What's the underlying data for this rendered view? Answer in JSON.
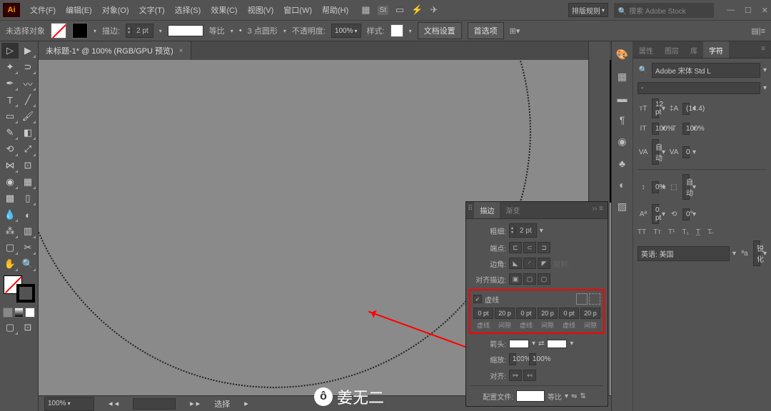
{
  "titlebar": {
    "logo": "Ai",
    "menu": [
      "文件(F)",
      "编辑(E)",
      "对象(O)",
      "文字(T)",
      "选择(S)",
      "效果(C)",
      "视图(V)",
      "窗口(W)",
      "帮助(H)"
    ],
    "layout_label": "排版规则",
    "search_placeholder": "🔍 搜索 Adobe Stock"
  },
  "controlbar": {
    "no_selection": "未选择对象",
    "stroke_label": "描边:",
    "stroke_weight": "2 pt",
    "profile_label": "等比",
    "brush_label": "3 点圆形",
    "opacity_label": "不透明度:",
    "opacity_value": "100%",
    "style_label": "样式:",
    "doc_setup": "文档设置",
    "prefs": "首选项"
  },
  "doc": {
    "tab_title": "未标题-1* @ 100% (RGB/GPU 预览)"
  },
  "status": {
    "zoom": "100%",
    "select_label": "选择"
  },
  "char_panel": {
    "tabs": [
      "属性",
      "图层",
      "库",
      "字符"
    ],
    "font": "Adobe 宋体 Std L",
    "style": "-",
    "size": "12 pt",
    "leading": "(14.4)",
    "vscale": "100%",
    "hscale": "100%",
    "kerning": "自动",
    "tracking": "0",
    "baseline": "0%",
    "color_auto": "自动",
    "shift": "0 pt",
    "rotation": "0°",
    "language": "英语: 美国",
    "aa": "锐化"
  },
  "stroke_panel": {
    "tabs": [
      "描边",
      "渐变"
    ],
    "weight_label": "粗细:",
    "weight": "2 pt",
    "cap_label": "端点:",
    "corner_label": "边角:",
    "limit_label": "限制:",
    "align_label": "对齐描边:",
    "dash_label": "虚线",
    "dash_values": [
      "0 pt",
      "20 p",
      "0 pt",
      "20 p",
      "0 pt",
      "20 p"
    ],
    "dash_sublabels": [
      "虚线",
      "间隙",
      "虚线",
      "间隙",
      "虚线",
      "间隙"
    ],
    "arrow_label": "箭头:",
    "scale_label": "缩放:",
    "scale1": "100%",
    "scale2": "100%",
    "align_arrow": "对齐:",
    "profile_label": "配置文件:",
    "profile_value": "等比"
  },
  "watermark": "姜无二"
}
